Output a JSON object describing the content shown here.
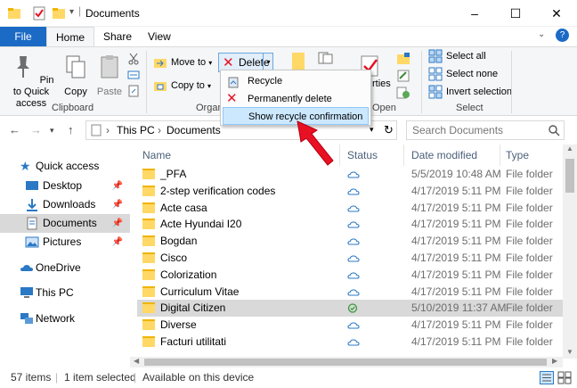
{
  "window": {
    "title": "Documents",
    "controls": {
      "minimize": "–",
      "maximize": "☐",
      "close": "✕"
    },
    "help_glyph": "?"
  },
  "tabs": [
    {
      "label": "File"
    },
    {
      "label": "Home"
    },
    {
      "label": "Share"
    },
    {
      "label": "View"
    }
  ],
  "ribbon": {
    "pin_quick_access": "Pin to Quick\naccess",
    "copy": "Copy",
    "paste": "Paste",
    "clipboard_group": "Clipboard",
    "move_to": "Move to",
    "copy_to": "Copy to",
    "delete": "Delete",
    "organize_group_partial": "Organ",
    "properties_partial": "rties",
    "open_group": "Open",
    "select_all": "Select all",
    "select_none": "Select none",
    "invert_selection": "Invert selection",
    "select_group": "Select"
  },
  "delete_menu": {
    "items": [
      {
        "label": "Recycle"
      },
      {
        "label": "Permanently delete"
      },
      {
        "label": "Show recycle confirmation"
      }
    ]
  },
  "address": {
    "path": [
      "This PC",
      "Documents"
    ],
    "separator": "›",
    "search_placeholder": "Search Documents"
  },
  "nav_pane": {
    "items": [
      {
        "label": "Quick access"
      },
      {
        "label": "Desktop"
      },
      {
        "label": "Downloads"
      },
      {
        "label": "Documents"
      },
      {
        "label": "Pictures"
      },
      {
        "label": "OneDrive"
      },
      {
        "label": "This PC"
      },
      {
        "label": "Network"
      }
    ]
  },
  "columns": [
    "Name",
    "Status",
    "Date modified",
    "Type"
  ],
  "files": [
    {
      "name": "_PFA",
      "status": "cloud",
      "date": "5/5/2019 10:48 AM",
      "type": "File folder"
    },
    {
      "name": "2-step verification codes",
      "status": "cloud",
      "date": "4/17/2019 5:11 PM",
      "type": "File folder"
    },
    {
      "name": "Acte casa",
      "status": "cloud",
      "date": "4/17/2019 5:11 PM",
      "type": "File folder"
    },
    {
      "name": "Acte Hyundai I20",
      "status": "cloud",
      "date": "4/17/2019 5:11 PM",
      "type": "File folder"
    },
    {
      "name": "Bogdan",
      "status": "cloud",
      "date": "4/17/2019 5:11 PM",
      "type": "File folder"
    },
    {
      "name": "Cisco",
      "status": "cloud",
      "date": "4/17/2019 5:11 PM",
      "type": "File folder"
    },
    {
      "name": "Colorization",
      "status": "cloud",
      "date": "4/17/2019 5:11 PM",
      "type": "File folder"
    },
    {
      "name": "Curriculum Vitae",
      "status": "cloud",
      "date": "4/17/2019 5:11 PM",
      "type": "File folder"
    },
    {
      "name": "Digital Citizen",
      "status": "synced",
      "date": "5/10/2019 11:37 AM",
      "type": "File folder"
    },
    {
      "name": "Diverse",
      "status": "cloud",
      "date": "4/17/2019 5:11 PM",
      "type": "File folder"
    },
    {
      "name": "Facturi utilitati",
      "status": "cloud",
      "date": "4/17/2019 5:11 PM",
      "type": "File folder"
    }
  ],
  "status_bar": {
    "item_count": "57 items",
    "selected": "1 item selected",
    "availability": "Available on this device"
  },
  "colors": {
    "file_tab": "#1b6ac5",
    "accent_red": "#e81123",
    "selection": "#cce8ff",
    "folder": "#ffd866"
  }
}
